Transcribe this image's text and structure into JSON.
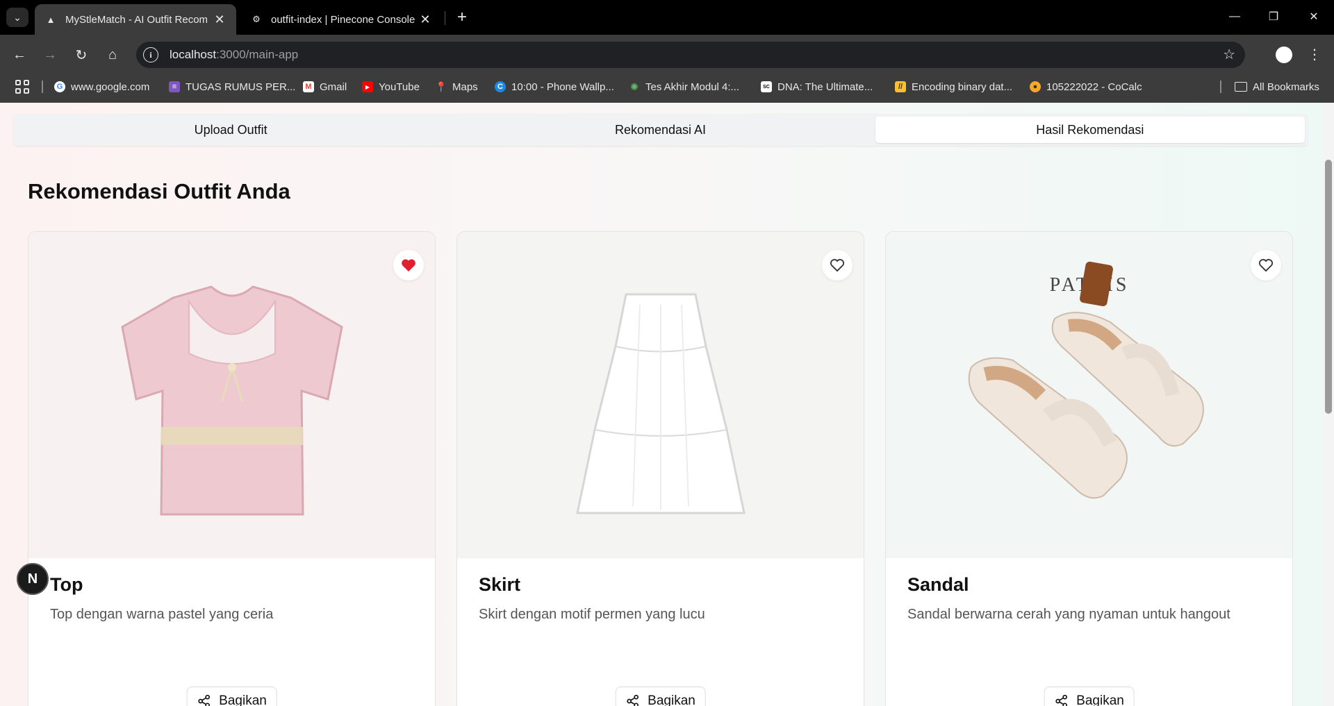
{
  "browser": {
    "tabs": [
      {
        "title": "MyStleMatch - AI Outfit Recom",
        "active": true
      },
      {
        "title": "outfit-index | Pinecone Console",
        "active": false
      }
    ],
    "url_host": "localhost",
    "url_path": ":3000/main-app",
    "bookmarks": [
      {
        "label": "www.google.com",
        "icon": "google-icon",
        "color": "#ffffff"
      },
      {
        "label": "TUGAS RUMUS PER...",
        "icon": "forms-icon",
        "color": "#7e57c2"
      },
      {
        "label": "Gmail",
        "icon": "gmail-icon",
        "color": "#ea4335"
      },
      {
        "label": "YouTube",
        "icon": "youtube-icon",
        "color": "#ff0000"
      },
      {
        "label": "Maps",
        "icon": "maps-icon",
        "color": "#34a853"
      },
      {
        "label": "10:00 - Phone Wallp...",
        "icon": "circle-c-icon",
        "color": "#1e88e5"
      },
      {
        "label": "Tes Akhir Modul 4:...",
        "icon": "sparkle-icon",
        "color": "#2e7d32"
      },
      {
        "label": "DNA: The Ultimate...",
        "icon": "scam-icon",
        "color": "#ffffff"
      },
      {
        "label": "Encoding binary dat...",
        "icon": "stripes-icon",
        "color": "#fbc02d"
      },
      {
        "label": "105222022 - CoCalc",
        "icon": "cocalc-icon",
        "color": "#f9a825"
      }
    ],
    "all_bookmarks": "All Bookmarks"
  },
  "nav_tabs": [
    {
      "label": "Upload Outfit",
      "active": false
    },
    {
      "label": "Rekomendasi AI",
      "active": false
    },
    {
      "label": "Hasil Rekomendasi",
      "active": true
    }
  ],
  "heading": "Rekomendasi Outfit Anda",
  "cards": [
    {
      "name": "Top",
      "desc": "Top dengan warna pastel yang ceria",
      "share": "Bagikan",
      "favorited": true
    },
    {
      "name": "Skirt",
      "desc": "Skirt dengan motif permen yang lucu",
      "share": "Bagikan",
      "favorited": false
    },
    {
      "name": "Sandal",
      "desc": "Sandal berwarna cerah yang nyaman untuk hangout",
      "share": "Bagikan",
      "favorited": false,
      "brand_text": "PATRIS"
    }
  ],
  "dev_badge": "N",
  "colors": {
    "favorite": "#e11d2e",
    "accent_bg": "#ffffff"
  }
}
